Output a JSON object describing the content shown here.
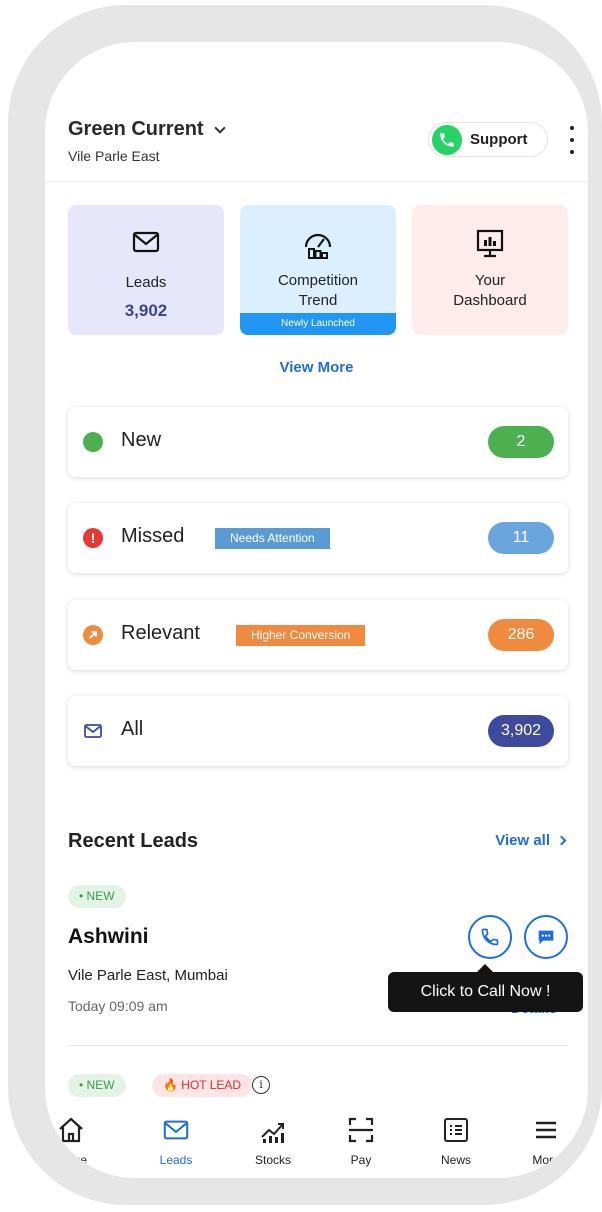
{
  "header": {
    "business_name": "Green Current",
    "location": "Vile Parle East",
    "support_label": "Support"
  },
  "tiles": {
    "leads": {
      "label": "Leads",
      "value": "3,902"
    },
    "competition": {
      "label_line1": "Competition",
      "label_line2": "Trend",
      "strip": "Newly Launched"
    },
    "dashboard": {
      "label_line1": "Your",
      "label_line2": "Dashboard"
    }
  },
  "view_more": "View More",
  "status_cards": {
    "new": {
      "label": "New",
      "count": "2",
      "color": "#4caf50"
    },
    "missed": {
      "label": "Missed",
      "tag": "Needs Attention",
      "count": "11",
      "color": "#e53935",
      "tag_color": "#5b9bd5"
    },
    "relevant": {
      "label": "Relevant",
      "tag": "Higher Conversion",
      "count": "286",
      "color": "#f08a3e"
    },
    "all": {
      "label": "All",
      "count": "3,902",
      "color": "#3f4a9f"
    }
  },
  "recent": {
    "title": "Recent Leads",
    "view_all": "View all",
    "lead1": {
      "badge": "• NEW",
      "name": "Ashwini",
      "location": "Vile Parle East, Mumbai",
      "time": "Today 09:09 am",
      "details": "Details"
    },
    "tooltip": "Click to Call Now !",
    "lead2": {
      "badge_new": "• NEW",
      "badge_hot": "HOT LEAD"
    }
  },
  "bottom_nav": {
    "home": "Home",
    "leads": "Leads",
    "stocks": "Stocks",
    "pay": "Pay",
    "news": "News",
    "more": "More"
  },
  "colors": {
    "accent": "#1e6fd9",
    "whatsapp": "#25d366"
  }
}
